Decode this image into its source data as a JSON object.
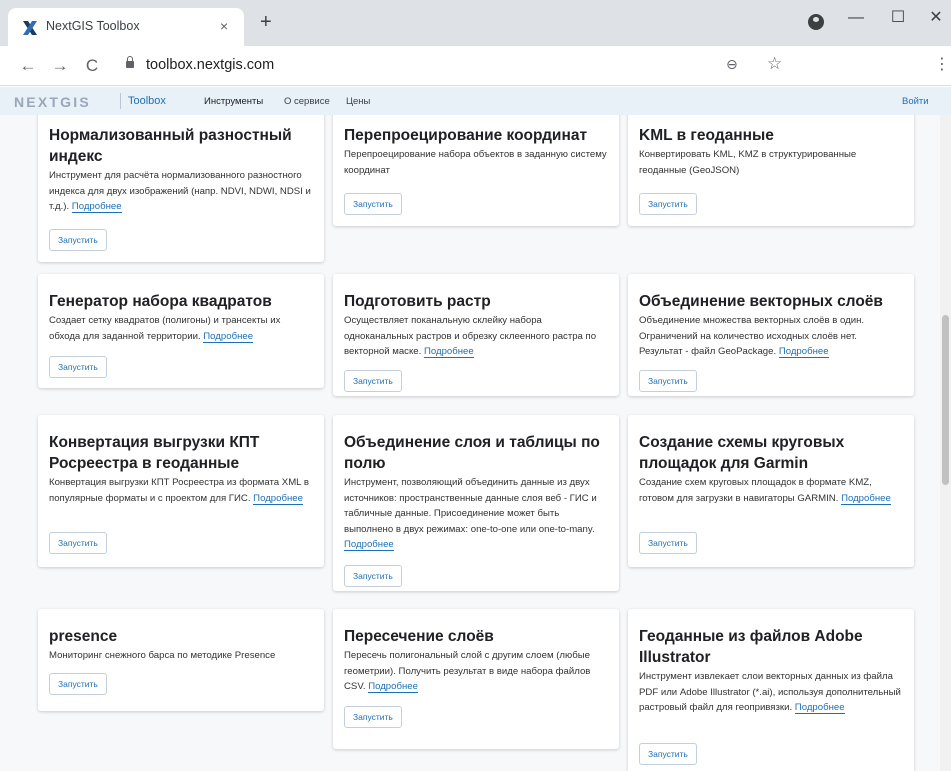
{
  "browser": {
    "tab_title": "NextGIS Toolbox",
    "tab_close": "×",
    "new_tab": "+",
    "url": "toolbox.nextgis.com",
    "back": "←",
    "forward": "→",
    "reload": "C",
    "zoom_icon": "⊖",
    "star_icon": "☆",
    "menu_icon": "⋮",
    "minimize": "—",
    "maximize": "☐",
    "close": "✕"
  },
  "site": {
    "logo": "NEXTGIS",
    "brand": "Toolbox",
    "nav": [
      "Инструменты",
      "О сервисе",
      "Цены"
    ],
    "login": "Войти"
  },
  "cards": [
    {
      "title": "Нормализованный разностный индекс",
      "desc": "Инструмент для расчёта нормализованного разностного индекса для двух изображений (напр. NDVI, NDWI, NDSI и т.д.).",
      "link": "Подробнее",
      "button": "Запустить"
    },
    {
      "title": "Перепроецирование координат",
      "desc": "Перепроецирование набора объектов в заданную систему координат",
      "link": "",
      "button": "Запустить"
    },
    {
      "title": "KML в геоданные",
      "desc": "Конвертировать KML, KMZ в структурированные геоданные (GeoJSON)",
      "link": "",
      "button": "Запустить"
    },
    {
      "title": "Генератор набора квадратов",
      "desc": "Создает сетку квадратов (полигоны) и трансекты их обхода для заданной территории.",
      "link": "Подробнее",
      "button": "Запустить"
    },
    {
      "title": "Подготовить растр",
      "desc": "Осуществляет поканальную склейку набора одноканальных растров и обрезку склеенного растра по векторной маске.",
      "link": "Подробнее",
      "button": "Запустить"
    },
    {
      "title": "Объединение векторных слоёв",
      "desc": "Объединение множества векторных слоёв в один. Ограничений на количество исходных слоёв нет. Результат - файл GeoPackage.",
      "link": "Подробнее",
      "button": "Запустить"
    },
    {
      "title": "Конвертация выгрузки КПТ Росреестра в геоданные",
      "desc": "Конвертация выгрузки КПТ Росреестра из формата XML в популярные форматы и с проектом для ГИС.",
      "link": "Подробнее",
      "button": "Запустить"
    },
    {
      "title": "Объединение слоя и таблицы по полю",
      "desc": "Инструмент, позволяющий объединить данные из двух источников: пространственные данные слоя веб - ГИС и табличные данные. Присоединение может быть выполнено в двух режимах: one-to-one или one-to-many.",
      "link": "Подробнее",
      "button": "Запустить"
    },
    {
      "title": "Создание схемы круговых площадок для Garmin",
      "desc": "Создание схем круговых площадок в формате KMZ, готовом для загрузки в навигаторы GARMIN.",
      "link": "Подробнее",
      "button": "Запустить"
    },
    {
      "title": "presence",
      "desc": "Мониторинг снежного барса по методике Presence",
      "link": "",
      "button": "Запустить"
    },
    {
      "title": "Пересечение слоёв",
      "desc": "Пересечь полигональный слой с другим слоем (любые геометрии). Получить результат в виде набора файлов CSV.",
      "link": "Подробнее",
      "button": "Запустить"
    },
    {
      "title": "Геоданные из файлов Adobe Illustrator",
      "desc": "Инструмент извлекает слои векторных данных из файла PDF или Adobe Illustrator (*.ai), используя дополнительный растровый файл для геопривязки.",
      "link": "Подробнее",
      "button": "Запустить"
    }
  ]
}
